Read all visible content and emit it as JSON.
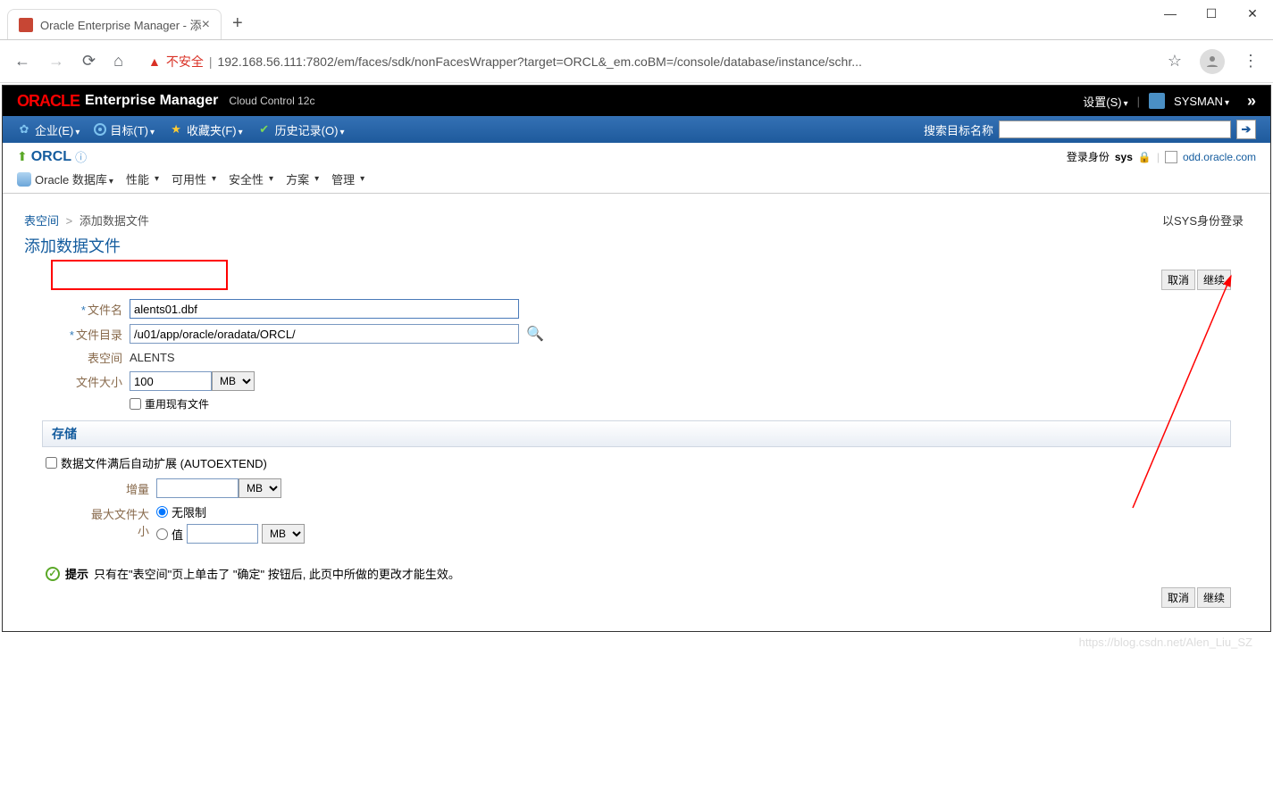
{
  "browser": {
    "tab_title": "Oracle Enterprise Manager - 添",
    "url_warning": "不安全",
    "url": "192.168.56.111:7802/em/faces/sdk/nonFacesWrapper?target=ORCL&_em.coBM=/console/database/instance/schr..."
  },
  "black_bar": {
    "brand": "ORACLE",
    "product": "Enterprise Manager",
    "subtitle": "Cloud Control 12c",
    "settings": "设置(S)",
    "user": "SYSMAN"
  },
  "blue_bar": {
    "items": [
      "企业(E)",
      "目标(T)",
      "收藏夹(F)",
      "历史记录(O)"
    ],
    "search_label": "搜索目标名称"
  },
  "sec_bar": {
    "db_name": "ORCL",
    "login_label": "登录身份",
    "login_user": "sys",
    "server": "odd.oracle.com",
    "menus": [
      "Oracle 数据库",
      "性能",
      "可用性",
      "安全性",
      "方案",
      "管理"
    ]
  },
  "page": {
    "breadcrumb_link": "表空间",
    "breadcrumb_sep": ">",
    "breadcrumb_cur": "添加数据文件",
    "title": "添加数据文件",
    "login_status": "以SYS身份登录",
    "cancel": "取消",
    "continue": "继续"
  },
  "form": {
    "file_name_label": "文件名",
    "file_name_value": "alents01.dbf",
    "file_dir_label": "文件目录",
    "file_dir_value": "/u01/app/oracle/oradata/ORCL/",
    "tablespace_label": "表空间",
    "tablespace_value": "ALENTS",
    "file_size_label": "文件大小",
    "file_size_value": "100",
    "unit": "MB",
    "reuse_label": "重用现有文件"
  },
  "storage": {
    "header": "存储",
    "autoextend_label": "数据文件满后自动扩展 (AUTOEXTEND)",
    "increment_label": "增量",
    "max_label": "最大文件大小",
    "unlimited_label": "无限制",
    "value_label": "值"
  },
  "note": {
    "label": "提示",
    "text": "只有在\"表空间\"页上单击了 \"确定\" 按钮后, 此页中所做的更改才能生效。"
  },
  "watermark": "https://blog.csdn.net/Alen_Liu_SZ"
}
